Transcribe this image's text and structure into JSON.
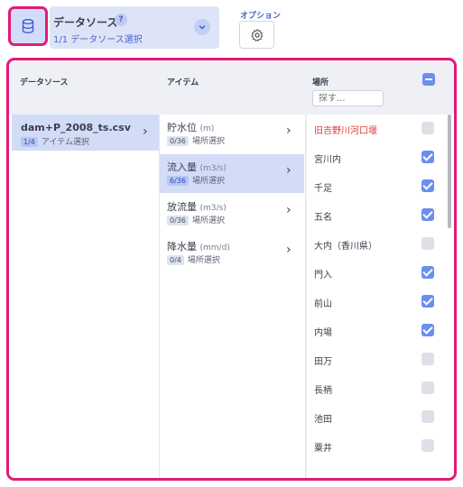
{
  "header": {
    "datasource_title": "データソース",
    "help_mark": "?",
    "datasource_subtitle": "1/1 データソース選択",
    "options_label": "オプション"
  },
  "columns": {
    "datasource": "データソース",
    "item": "アイテム",
    "place": "場所",
    "search_placeholder": "探す..."
  },
  "datasources": [
    {
      "name": "dam+P_2008_ts.csv",
      "badge": "1/4",
      "caption": "アイテム選択",
      "selected": true
    }
  ],
  "items": [
    {
      "name": "貯水位",
      "unit": "(m)",
      "badge": "0/36",
      "caption": "場所選択",
      "selected": false
    },
    {
      "name": "流入量",
      "unit": "(m3/s)",
      "badge": "6/36",
      "caption": "場所選択",
      "selected": true
    },
    {
      "name": "放流量",
      "unit": "(m3/s)",
      "badge": "0/36",
      "caption": "場所選択",
      "selected": false
    },
    {
      "name": "降水量",
      "unit": "(mm/d)",
      "badge": "0/4",
      "caption": "場所選択",
      "selected": false
    }
  ],
  "places": [
    {
      "name": "旧吉野川河口堰",
      "checked": false,
      "highlight": true
    },
    {
      "name": "宮川内",
      "checked": true,
      "highlight": false
    },
    {
      "name": "千足",
      "checked": true,
      "highlight": false
    },
    {
      "name": "五名",
      "checked": true,
      "highlight": false
    },
    {
      "name": "大内（香川県）",
      "checked": false,
      "highlight": false
    },
    {
      "name": "門入",
      "checked": true,
      "highlight": false
    },
    {
      "name": "前山",
      "checked": true,
      "highlight": false
    },
    {
      "name": "内場",
      "checked": true,
      "highlight": false
    },
    {
      "name": "田万",
      "checked": false,
      "highlight": false
    },
    {
      "name": "長柄",
      "checked": false,
      "highlight": false
    },
    {
      "name": "池田",
      "checked": false,
      "highlight": false
    },
    {
      "name": "粟井",
      "checked": false,
      "highlight": false
    }
  ],
  "colors": {
    "accent": "#4a62c9",
    "highlight_box": "#e21a76",
    "selected_row": "#d3dcf7",
    "checkbox_on": "#6b8ef0",
    "warning_text": "#e03a3a"
  }
}
